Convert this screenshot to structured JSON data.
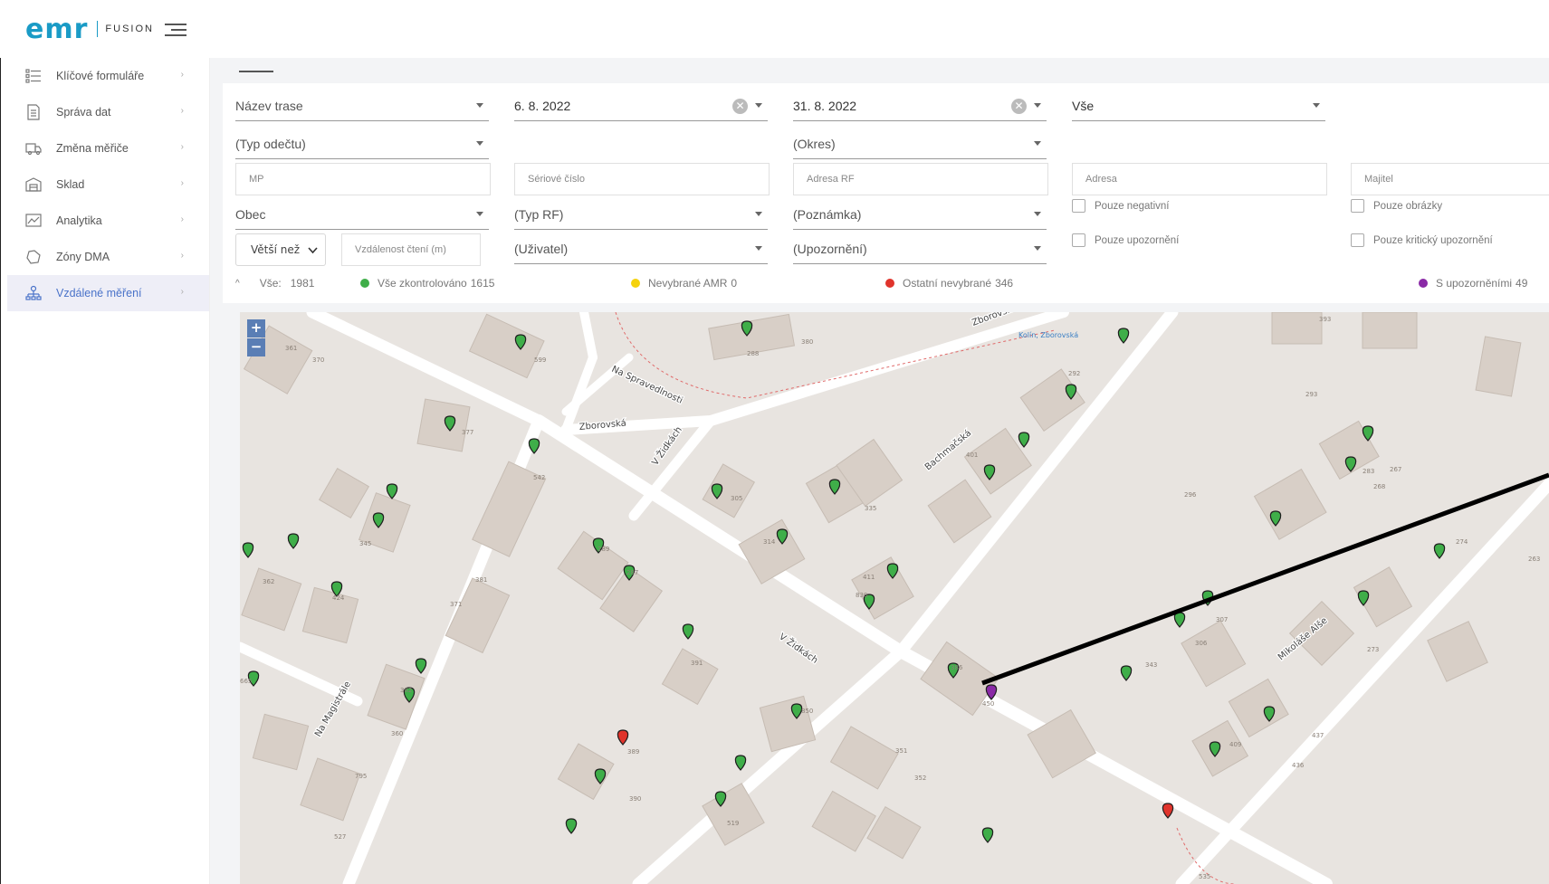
{
  "brand": {
    "name": "emr",
    "product": "FUSION"
  },
  "sidebar": {
    "items": [
      {
        "label": "Klíčové formuláře",
        "icon": "list-icon"
      },
      {
        "label": "Správa dat",
        "icon": "document-icon"
      },
      {
        "label": "Změna měřiče",
        "icon": "truck-icon"
      },
      {
        "label": "Sklad",
        "icon": "warehouse-icon"
      },
      {
        "label": "Analytika",
        "icon": "chart-icon"
      },
      {
        "label": "Zóny DMA",
        "icon": "zone-icon"
      },
      {
        "label": "Vzdálené měření",
        "icon": "network-icon",
        "active": true
      }
    ]
  },
  "filters": {
    "route_name": "Název trase",
    "date_from": "6. 8. 2022",
    "date_to": "31. 8. 2022",
    "all": "Vše",
    "reading_type": "(Typ odečtu)",
    "district": "(Okres)",
    "mp_placeholder": "MP",
    "serial_placeholder": "Sériové číslo",
    "rf_address_placeholder": "Adresa RF",
    "address_placeholder": "Adresa",
    "owner_placeholder": "Majitel",
    "municipality": "Obec",
    "rf_type": "(Typ RF)",
    "note": "(Poznámka)",
    "only_negative": "Pouze negativní",
    "only_images": "Pouze obrázky",
    "greater_than": "Větší než",
    "distance_placeholder": "Vzdálenost čtení (m)",
    "user": "(Uživatel)",
    "warning": "(Upozornění)",
    "only_warnings": "Pouze upozornění",
    "only_critical": "Pouze kritický upozornění"
  },
  "legend": {
    "all": "Vše:",
    "all_count": "1981",
    "checked": "Vše zkontrolováno",
    "checked_count": "1615",
    "unselected_amr": "Nevybrané AMR",
    "unselected_amr_count": "0",
    "other_unselected": "Ostatní nevybrané",
    "other_unselected_count": "346",
    "with_warnings": "S upozorněními",
    "with_warnings_count": "49"
  },
  "colors": {
    "accent": "#1a9bc6",
    "nav_active": "#4a73c9",
    "green": "#3fae49",
    "yellow": "#f5d20c",
    "red": "#e0342c",
    "purple": "#8a2aa6"
  },
  "map": {
    "streets": [
      "Zborovská",
      "Zborovská",
      "Na Spravedlnosti",
      "V Židkách",
      "Bachmačská",
      "V Židkách",
      "Na Magistrále",
      "Mikoláše Alše"
    ],
    "poi": "Kolín, Zborovská",
    "zoom_in": "+",
    "zoom_out": "−",
    "house_numbers": [
      "361",
      "370",
      "599",
      "288",
      "380",
      "393",
      "292",
      "377",
      "542",
      "305",
      "283",
      "401",
      "296",
      "293",
      "267",
      "268",
      "345",
      "335",
      "314",
      "274",
      "362",
      "424",
      "381",
      "371",
      "289",
      "287",
      "411",
      "830",
      "263",
      "307",
      "306",
      "273",
      "391",
      "386",
      "450",
      "343",
      "665",
      "382",
      "360",
      "795",
      "527",
      "850",
      "351",
      "352",
      "437",
      "436",
      "409",
      "389",
      "390",
      "519",
      "535"
    ]
  }
}
